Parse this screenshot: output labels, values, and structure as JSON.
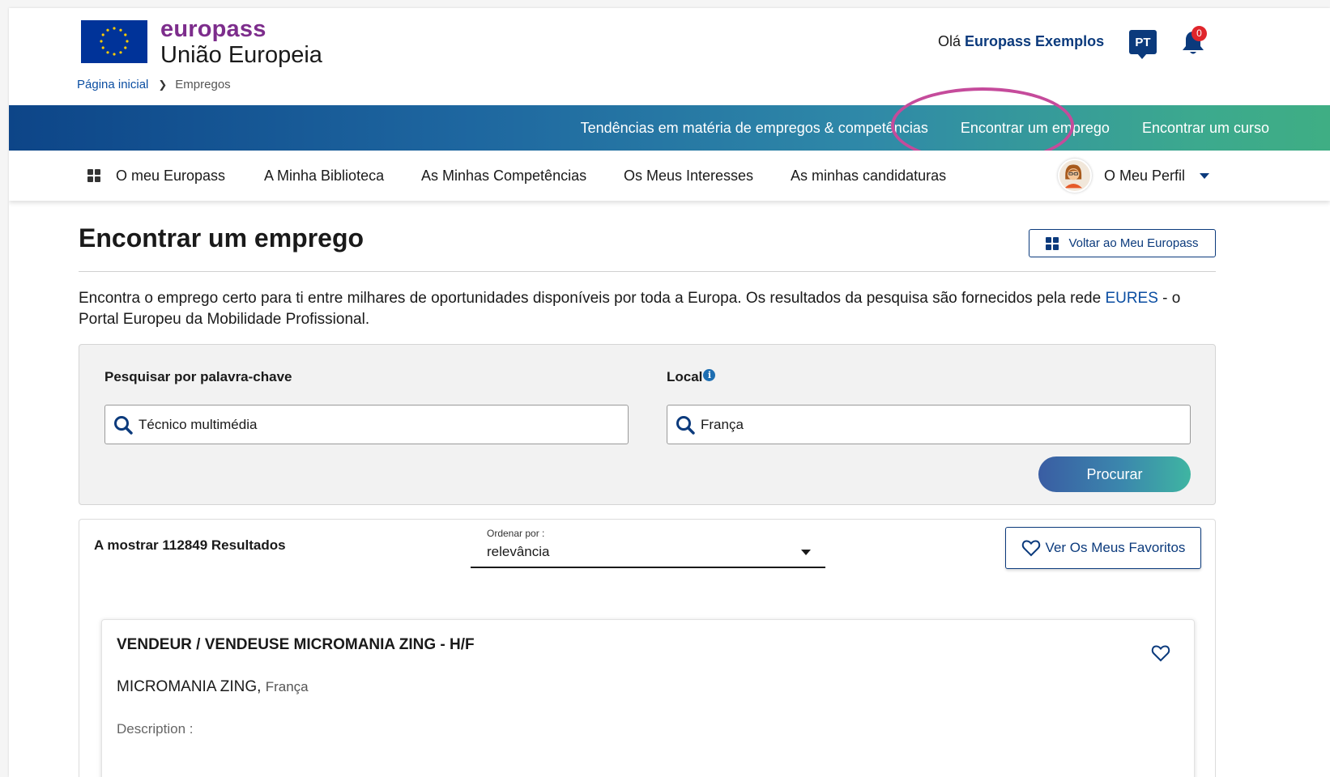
{
  "brand": {
    "name": "europass",
    "subtitle": "União Europeia",
    "flag_color": "#003399",
    "name_color": "#7d2d8c"
  },
  "breadcrumb": {
    "home": "Página inicial",
    "current": "Empregos"
  },
  "header": {
    "greeting_prefix": "Olá ",
    "user_name": "Europass Exemplos",
    "language": "PT",
    "notification_count": "0",
    "icon": "bell-icon"
  },
  "top_nav": {
    "items": [
      "Tendências em matéria de empregos & competências",
      "Encontrar um emprego",
      "Encontrar um curso"
    ],
    "highlight_color": "#c54b9b"
  },
  "sub_nav": {
    "items": [
      "O meu Europass",
      "A Minha Biblioteca",
      "As Minhas Competências",
      "Os Meus Interesses",
      "As minhas candidaturas"
    ],
    "profile": "O Meu Perfil"
  },
  "main": {
    "title": "Encontrar um emprego",
    "back_button": "Voltar ao Meu Europass",
    "intro_text": "Encontra o emprego certo para ti entre milhares de oportunidades disponíveis por toda a Europa. Os resultados da pesquisa são fornecidos pela rede ",
    "intro_link": "EURES",
    "intro_suffix": " - o Portal Europeu da Mobilidade Profissional."
  },
  "search": {
    "keyword_label": "Pesquisar por palavra-chave",
    "keyword_value": "Técnico multimédia",
    "location_label": "Local",
    "location_value": "França",
    "button": "Procurar"
  },
  "results": {
    "count_text": "A mostrar 112849 Resultados",
    "sort_label": "Ordenar por :",
    "sort_value": "relevância",
    "favorites_button": "Ver Os Meus Favoritos",
    "jobs": [
      {
        "title": "VENDEUR / VENDEUSE MICROMANIA ZING - H/F",
        "company": "MICROMANIA ZING,",
        "location": "França",
        "description_label": "Description :"
      }
    ]
  },
  "colors": {
    "primary": "#0b3a7c",
    "link": "#0b4ea2",
    "badge": "#e0252b"
  }
}
